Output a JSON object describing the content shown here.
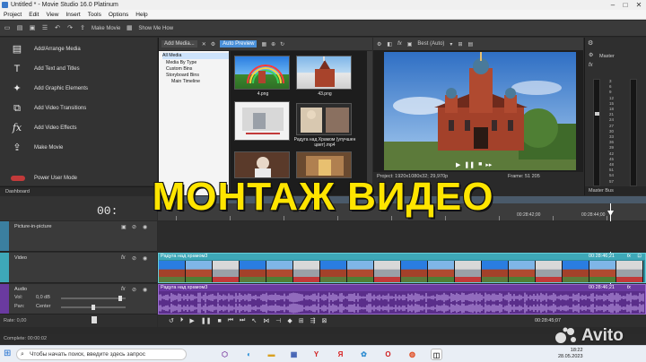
{
  "window": {
    "title": "Untitled * - Movie Studio 16.0 Platinum"
  },
  "menu": [
    "Project",
    "Edit",
    "View",
    "Insert",
    "Tools",
    "Options",
    "Help"
  ],
  "toolbar": {
    "make_movie_label": "Make Movie",
    "show_me_how_label": "Show Me How"
  },
  "left_panel": {
    "items": [
      {
        "label": "Add/Arrange Media",
        "icon": "arrange-icon"
      },
      {
        "label": "Add Text and Titles",
        "icon": "text-icon"
      },
      {
        "label": "Add Graphic Elements",
        "icon": "graphic-icon"
      },
      {
        "label": "Add Video Transitions",
        "icon": "transition-icon"
      },
      {
        "label": "Add Video Effects",
        "icon": "fx-icon"
      },
      {
        "label": "Make Movie",
        "icon": "movie-icon"
      },
      {
        "label": "Power User Mode",
        "icon": "toggle-icon"
      }
    ],
    "tab_label": "Dashboard"
  },
  "media": {
    "add_media_label": "Add Media...",
    "auto_preview_label": "Auto Preview",
    "tree": [
      {
        "label": "All Media",
        "selected": true
      },
      {
        "label": "Media By Type",
        "selected": false
      },
      {
        "label": "Custom Bins",
        "selected": false
      },
      {
        "label": "Storyboard Bins",
        "selected": false
      },
      {
        "label": "Main Timeline",
        "selected": false
      }
    ],
    "thumbs": [
      {
        "label": "4.png"
      },
      {
        "label": "43.png"
      },
      {
        "label": ""
      },
      {
        "label": "Радуга над Храмом (улучшен цвет).mp4"
      },
      {
        "label": ""
      },
      {
        "label": ""
      }
    ]
  },
  "preview": {
    "quality_label": "Best (Auto)",
    "project_info": "Project:  1920x1080x32; 29,970p",
    "frame_info": "Frame:    51 205"
  },
  "master": {
    "label": "Master",
    "bus_tab": "Master Bus",
    "db_ticks": [
      "3",
      "6",
      "9",
      "12",
      "15",
      "18",
      "21",
      "24",
      "27",
      "30",
      "33",
      "36",
      "39",
      "42",
      "45",
      "48",
      "51",
      "54",
      "57"
    ]
  },
  "timeline": {
    "time_display": "00:",
    "ruler_times": [
      "00:28:42;00",
      "00:28:44;00"
    ],
    "tracks": [
      {
        "name": "Picture-in-picture"
      },
      {
        "name": "Video",
        "clip_title": "Радуга над храмом3",
        "clip_time": "00:28:46;21"
      },
      {
        "name": "Audio",
        "clip_title": "Радуга над храмом3",
        "clip_time": "00:28:46;21",
        "vol_label": "Vol:",
        "vol_value": "0,0 dB",
        "pan_label": "Pan:",
        "pan_value": "Center"
      }
    ],
    "rate_label": "Rate: 0,00",
    "end_time": "00:28:45;07",
    "status": "Complete: 00:00:02"
  },
  "overlay": {
    "title": "МОНТАЖ ВИДЕО"
  },
  "taskbar": {
    "search_placeholder": "Чтобы начать поиск, введите здесь запрос",
    "time": "18:22",
    "date": "28.05.2023"
  },
  "watermark": {
    "text": "Avito"
  },
  "colors": {
    "accent": "#4a90d9",
    "video_clip": "#3ea8b8",
    "audio_clip": "#6a3aa0",
    "overlay_title": "#ffe500"
  }
}
